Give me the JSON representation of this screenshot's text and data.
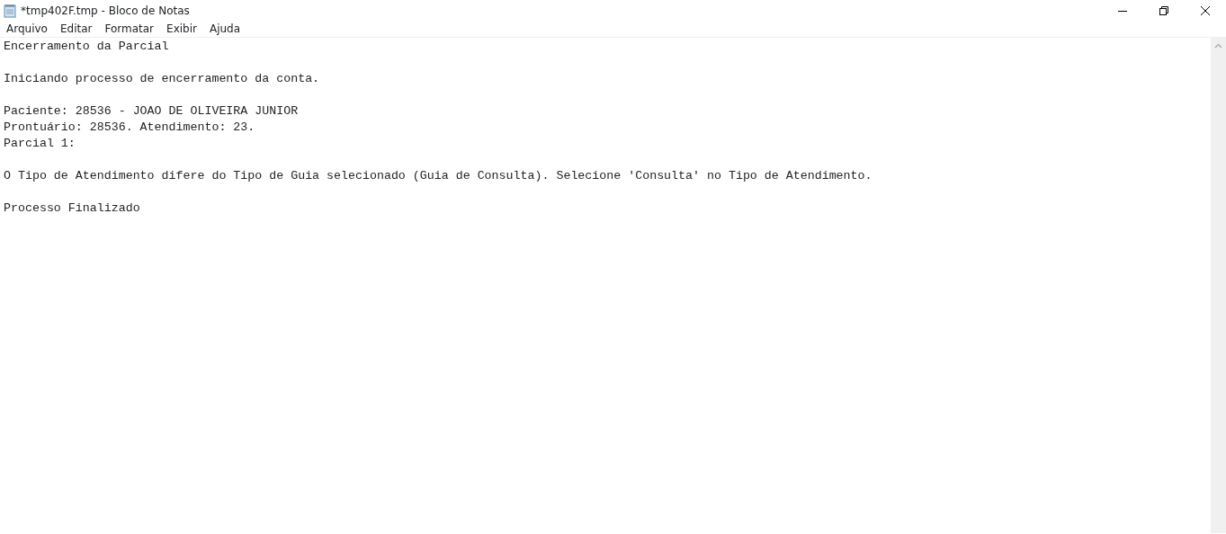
{
  "window": {
    "title": "*tmp402F.tmp - Bloco de Notas"
  },
  "menu": [
    "Arquivo",
    "Editar",
    "Formatar",
    "Exibir",
    "Ajuda"
  ],
  "document": {
    "paragraphs": [
      [
        "Encerramento da Parcial"
      ],
      [
        "Iniciando processo de encerramento da conta."
      ],
      [
        "Paciente: 28536 - JOAO DE OLIVEIRA JUNIOR",
        "Prontuário: 28536. Atendimento: 23.",
        "Parcial 1:"
      ],
      [
        "O Tipo de Atendimento difere do Tipo de Guia selecionado (Guia de Consulta). Selecione 'Consulta' no Tipo de Atendimento."
      ],
      [
        "Processo Finalizado"
      ]
    ]
  }
}
